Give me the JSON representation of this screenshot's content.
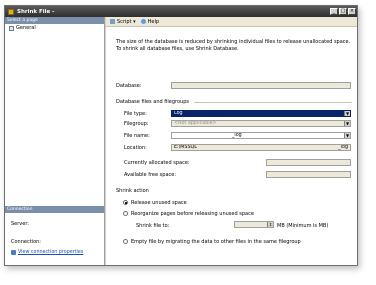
{
  "window": {
    "title": "Shrink File -",
    "min": "_",
    "max": "□",
    "close": "×"
  },
  "left": {
    "select_page": "Select a page",
    "pages": [
      "General"
    ],
    "connection_header": "Connection",
    "server_label": "Server:",
    "connection_label": "Connection:",
    "view_link": "View connection properties"
  },
  "toolbar": {
    "script": "Script ▾",
    "help": "Help"
  },
  "main": {
    "description": "The size of the database is reduced by shrinking individual files to release unallocated space. To shrink all database files, use Shrink Database.",
    "database_label": "Database:",
    "database_value": "",
    "files_group": "Database files and filegroups",
    "file_type_label": "File type:",
    "file_type_value": "Log",
    "filegroup_label": "Filegroup:",
    "filegroup_value": "<Not applicable>",
    "file_name_label": "File name:",
    "file_name_value": "_log",
    "location_label": "Location:",
    "location_value": "E:\\MSSQL",
    "location_suffix": "_log",
    "allocated_label": "Currently allocated space:",
    "free_label": "Available free space:",
    "shrink_action": "Shrink action",
    "opt_release": "Release unused space",
    "opt_reorganize": "Reorganize pages before releasing unused space",
    "shrink_to_label": "Shrink file to:",
    "mb_text": "MB (Minimum is    MB)",
    "opt_empty": "Empty file by migrating the data to other files in the same filegroup"
  }
}
